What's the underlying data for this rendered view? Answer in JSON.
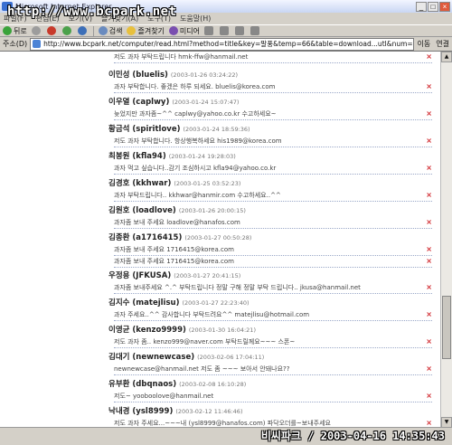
{
  "window": {
    "title": "Microsoft Internet Explorer",
    "watermark": "http://www.bcpark.net"
  },
  "menu": [
    "파일(F)",
    "편집(E)",
    "보기(V)",
    "즐겨찾기(A)",
    "도구(T)",
    "도움말(H)"
  ],
  "toolbar": {
    "back": "뒤로",
    "search": "검색",
    "favorites": "즐겨찾기",
    "media": "미디어"
  },
  "address": {
    "label": "주소(D)",
    "url": "http://www.bcpark.net/computer/read.html?method=title&key=말풍&temp=66&table=download...utl&num=2029&no=2698&",
    "go": "이동",
    "links": "연결"
  },
  "entries": [
    {
      "name": "",
      "date": "",
      "comments": [
        "저도 과자 부탁드립니다 hmk-ffw@hanmail.net"
      ]
    },
    {
      "name": "이민성 (bluelis)",
      "date": "(2003-01-26 03:24:22)",
      "comments": [
        "과자 부탁합니다. 좋겠은 하루 되세요. bluelis@korea.com"
      ]
    },
    {
      "name": "이우열 (caplwy)",
      "date": "(2003-01-24 15:07:47)",
      "comments": [
        "늦었지만 과자좀~^^ caplwy@yahoo.co.kr 수고하세요~"
      ]
    },
    {
      "name": "황금석 (spiritlove)",
      "date": "(2003-01-24 18:59:36)",
      "comments": [
        "저도 과자 부탁합니다. 항상행복하세요 his1989@korea.com"
      ]
    },
    {
      "name": "최봉원 (kfla94)",
      "date": "(2003-01-24 19:28:03)",
      "comments": [
        "과자 먹고 싶습니다..감기 조심하시고 kfla94@yahoo.co.kr"
      ]
    },
    {
      "name": "김경호 (kkhwar)",
      "date": "(2003-01-25 03:52:23)",
      "comments": [
        "과자 부탁드립니다.. kkhwar@hanmir.com 수고하세요..^^"
      ]
    },
    {
      "name": "김원호 (loadlove)",
      "date": "(2003-01-26 20:00:15)",
      "comments": [
        "과자좀 보내 주세요 loadlove@hanafos.com"
      ]
    },
    {
      "name": "김종환 (a1716415)",
      "date": "(2003-01-27 00:50:28)",
      "comments": [
        "과자좀 보내 주세요 1716415@korea.com",
        "과자좀 보내 주세요 1716415@korea.com"
      ]
    },
    {
      "name": "우정용 (JFKUSA)",
      "date": "(2003-01-27 20:41:15)",
      "comments": [
        "과자좀 보내주세요 ^.^ 부탁드립니다 정말 구해 정말 부탁 드립니다.. jkusa@hanmail.net"
      ]
    },
    {
      "name": "김지수 (matejlisu)",
      "date": "(2003-01-27 22:23:40)",
      "comments": [
        "과자 주세요..^^ 감사합니다 부탁드려요^^ matejlisu@hotmail.com"
      ]
    },
    {
      "name": "이영균 (kenzo9999)",
      "date": "(2003-01-30 16:04:21)",
      "comments": [
        "저도 과자 좀.. kenzo999@naver.com 부탁드릴께요~~~ 스폰~"
      ]
    },
    {
      "name": "김대기 (newnewcase)",
      "date": "(2003-02-06 17:04:11)",
      "comments": [
        "newnewcase@hanmail.net 저도 좀 ~~~ 보아서 안돼나요??"
      ]
    },
    {
      "name": "유부환 (dbqnaos)",
      "date": "(2003-02-08 16:10:28)",
      "comments": [
        "저도~ yooboolove@hanmail.net"
      ]
    },
    {
      "name": "낙내경 (ysl8999)",
      "date": "(2003-02-12 11:46:46)",
      "comments": [
        "저도 과자 주세요...~~~내 (ysl8999@hanafos.com) 파닥오더를~보내주세요"
      ]
    }
  ],
  "delete_symbol": "×",
  "stamp": "비씨파크 / 2003-04-16 14:35:43"
}
